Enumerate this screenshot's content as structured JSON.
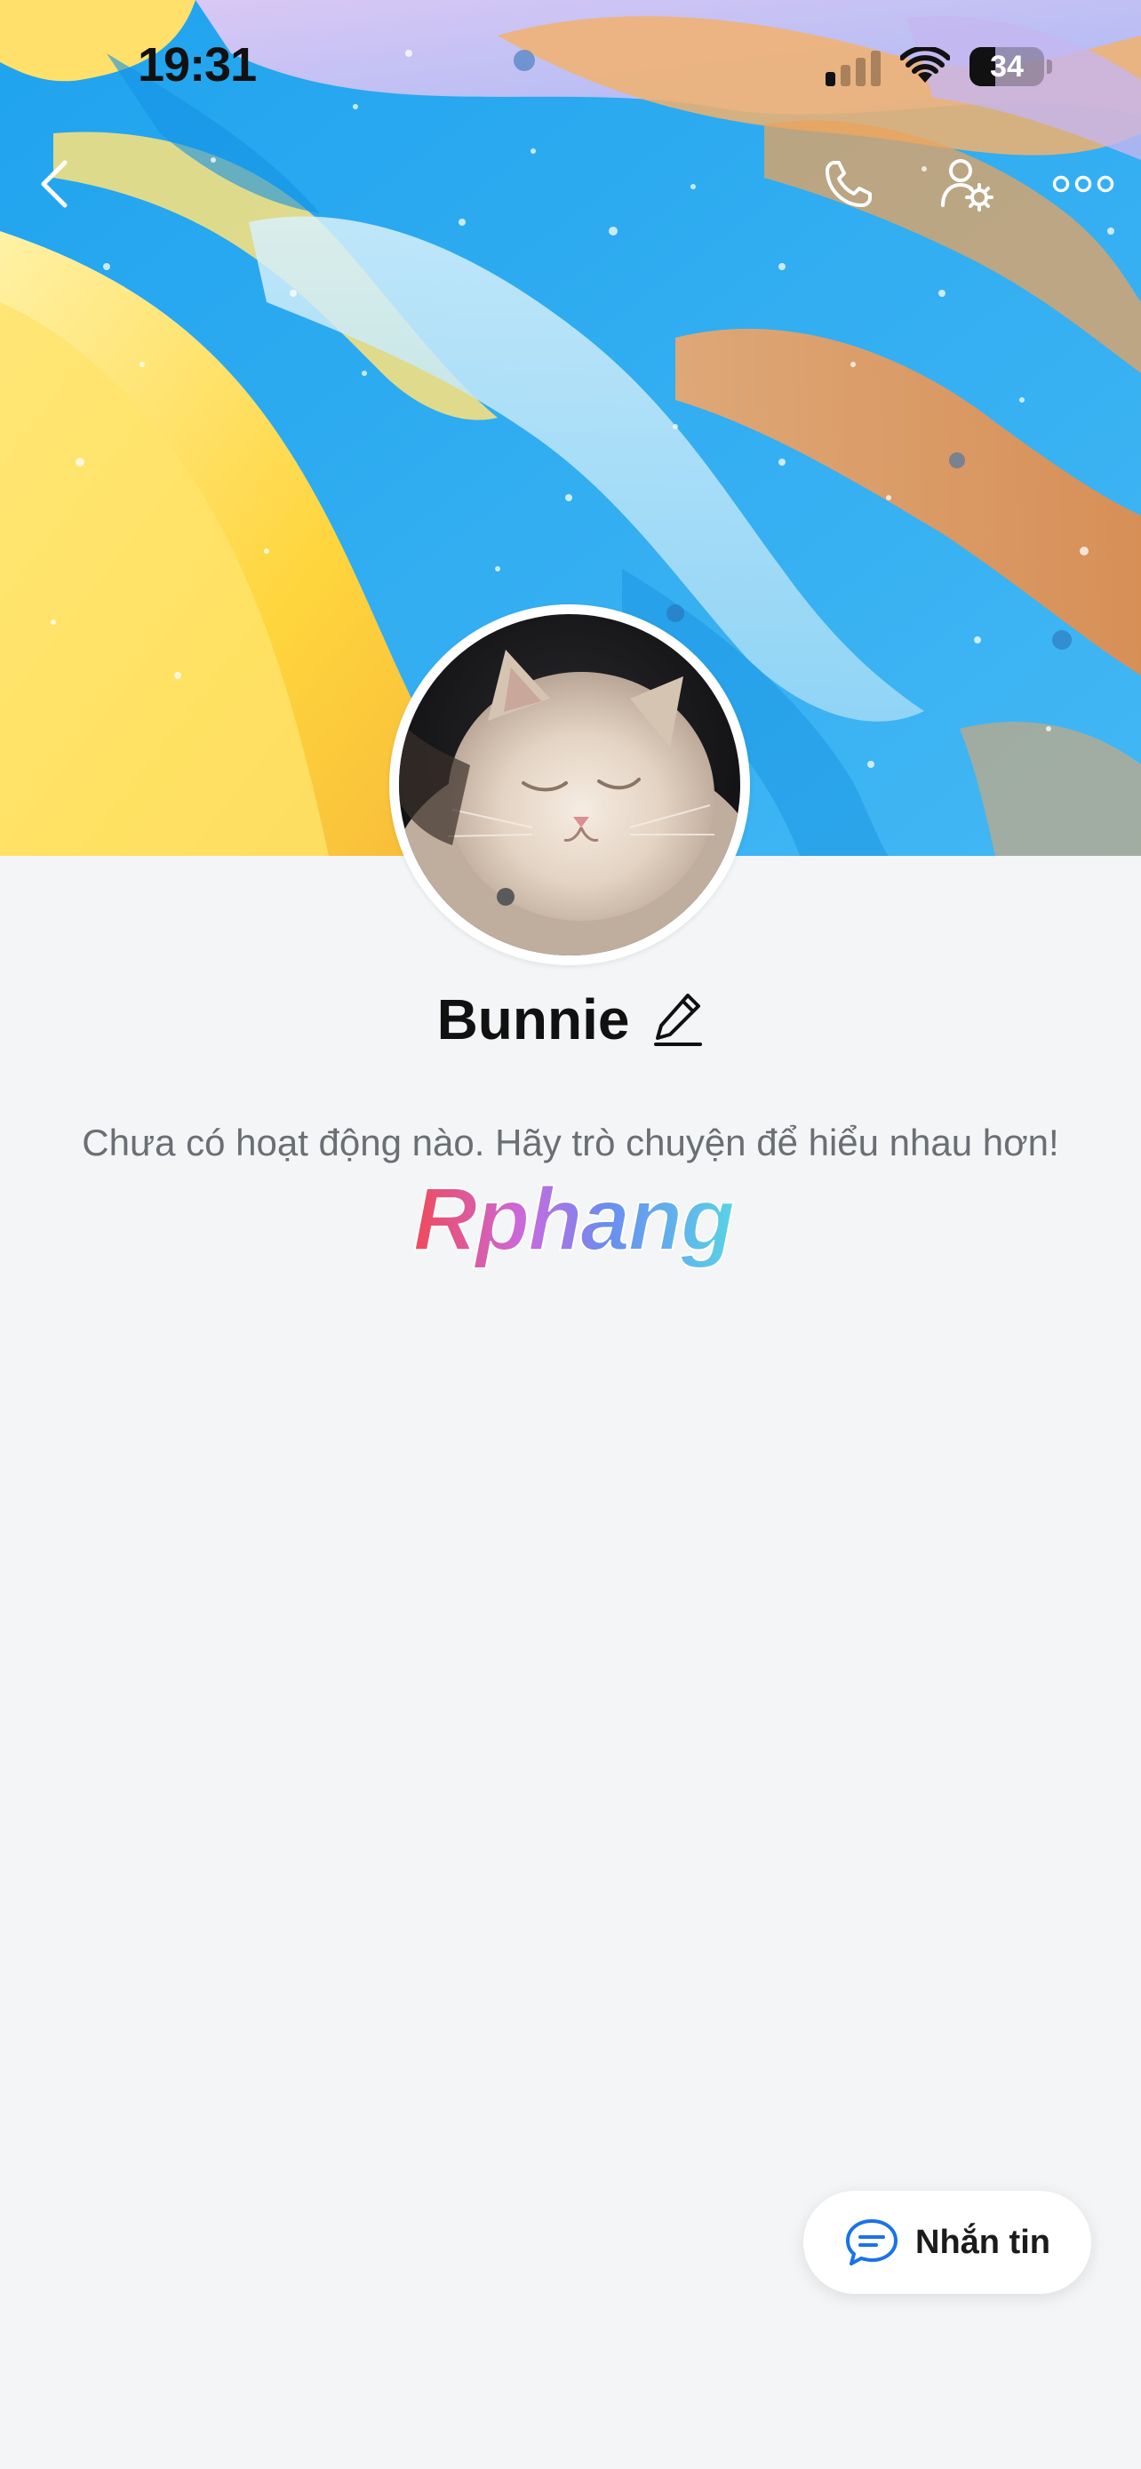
{
  "status_bar": {
    "time": "19:31",
    "battery": "34",
    "battery_level": 0.34,
    "signal_bars_active": 1,
    "signal_bars_total": 4
  },
  "header": {
    "icons": [
      "back-icon",
      "phone-icon",
      "user-settings-icon",
      "more-icon"
    ]
  },
  "profile": {
    "name": "Bunnie",
    "empty_activity": "Chưa có hoạt động nào. Hãy trò chuyện để hiểu nhau hơn!"
  },
  "watermark": {
    "text": "Rphang"
  },
  "actions": {
    "message_label": "Nhắn tin"
  },
  "colors": {
    "background": "#f4f5f7",
    "accent": "#1a73e8",
    "text_primary": "#111111",
    "text_secondary": "#6b6e73"
  }
}
